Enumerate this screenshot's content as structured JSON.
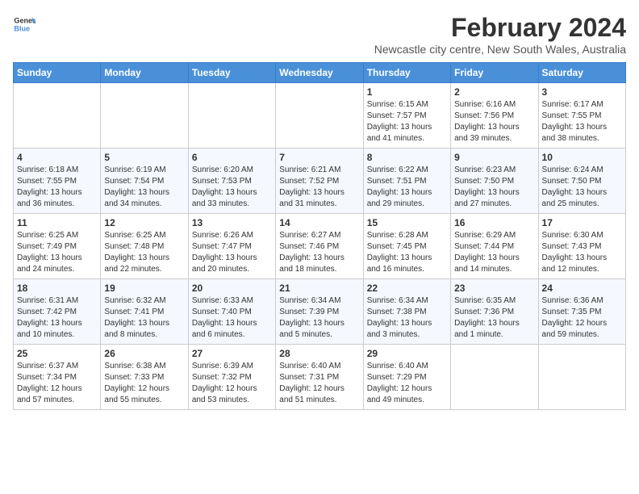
{
  "header": {
    "logo_line1": "General",
    "logo_line2": "Blue",
    "month_title": "February 2024",
    "location": "Newcastle city centre, New South Wales, Australia"
  },
  "weekdays": [
    "Sunday",
    "Monday",
    "Tuesday",
    "Wednesday",
    "Thursday",
    "Friday",
    "Saturday"
  ],
  "weeks": [
    [
      {
        "day": "",
        "info": ""
      },
      {
        "day": "",
        "info": ""
      },
      {
        "day": "",
        "info": ""
      },
      {
        "day": "",
        "info": ""
      },
      {
        "day": "1",
        "info": "Sunrise: 6:15 AM\nSunset: 7:57 PM\nDaylight: 13 hours\nand 41 minutes."
      },
      {
        "day": "2",
        "info": "Sunrise: 6:16 AM\nSunset: 7:56 PM\nDaylight: 13 hours\nand 39 minutes."
      },
      {
        "day": "3",
        "info": "Sunrise: 6:17 AM\nSunset: 7:55 PM\nDaylight: 13 hours\nand 38 minutes."
      }
    ],
    [
      {
        "day": "4",
        "info": "Sunrise: 6:18 AM\nSunset: 7:55 PM\nDaylight: 13 hours\nand 36 minutes."
      },
      {
        "day": "5",
        "info": "Sunrise: 6:19 AM\nSunset: 7:54 PM\nDaylight: 13 hours\nand 34 minutes."
      },
      {
        "day": "6",
        "info": "Sunrise: 6:20 AM\nSunset: 7:53 PM\nDaylight: 13 hours\nand 33 minutes."
      },
      {
        "day": "7",
        "info": "Sunrise: 6:21 AM\nSunset: 7:52 PM\nDaylight: 13 hours\nand 31 minutes."
      },
      {
        "day": "8",
        "info": "Sunrise: 6:22 AM\nSunset: 7:51 PM\nDaylight: 13 hours\nand 29 minutes."
      },
      {
        "day": "9",
        "info": "Sunrise: 6:23 AM\nSunset: 7:50 PM\nDaylight: 13 hours\nand 27 minutes."
      },
      {
        "day": "10",
        "info": "Sunrise: 6:24 AM\nSunset: 7:50 PM\nDaylight: 13 hours\nand 25 minutes."
      }
    ],
    [
      {
        "day": "11",
        "info": "Sunrise: 6:25 AM\nSunset: 7:49 PM\nDaylight: 13 hours\nand 24 minutes."
      },
      {
        "day": "12",
        "info": "Sunrise: 6:25 AM\nSunset: 7:48 PM\nDaylight: 13 hours\nand 22 minutes."
      },
      {
        "day": "13",
        "info": "Sunrise: 6:26 AM\nSunset: 7:47 PM\nDaylight: 13 hours\nand 20 minutes."
      },
      {
        "day": "14",
        "info": "Sunrise: 6:27 AM\nSunset: 7:46 PM\nDaylight: 13 hours\nand 18 minutes."
      },
      {
        "day": "15",
        "info": "Sunrise: 6:28 AM\nSunset: 7:45 PM\nDaylight: 13 hours\nand 16 minutes."
      },
      {
        "day": "16",
        "info": "Sunrise: 6:29 AM\nSunset: 7:44 PM\nDaylight: 13 hours\nand 14 minutes."
      },
      {
        "day": "17",
        "info": "Sunrise: 6:30 AM\nSunset: 7:43 PM\nDaylight: 13 hours\nand 12 minutes."
      }
    ],
    [
      {
        "day": "18",
        "info": "Sunrise: 6:31 AM\nSunset: 7:42 PM\nDaylight: 13 hours\nand 10 minutes."
      },
      {
        "day": "19",
        "info": "Sunrise: 6:32 AM\nSunset: 7:41 PM\nDaylight: 13 hours\nand 8 minutes."
      },
      {
        "day": "20",
        "info": "Sunrise: 6:33 AM\nSunset: 7:40 PM\nDaylight: 13 hours\nand 6 minutes."
      },
      {
        "day": "21",
        "info": "Sunrise: 6:34 AM\nSunset: 7:39 PM\nDaylight: 13 hours\nand 5 minutes."
      },
      {
        "day": "22",
        "info": "Sunrise: 6:34 AM\nSunset: 7:38 PM\nDaylight: 13 hours\nand 3 minutes."
      },
      {
        "day": "23",
        "info": "Sunrise: 6:35 AM\nSunset: 7:36 PM\nDaylight: 13 hours\nand 1 minute."
      },
      {
        "day": "24",
        "info": "Sunrise: 6:36 AM\nSunset: 7:35 PM\nDaylight: 12 hours\nand 59 minutes."
      }
    ],
    [
      {
        "day": "25",
        "info": "Sunrise: 6:37 AM\nSunset: 7:34 PM\nDaylight: 12 hours\nand 57 minutes."
      },
      {
        "day": "26",
        "info": "Sunrise: 6:38 AM\nSunset: 7:33 PM\nDaylight: 12 hours\nand 55 minutes."
      },
      {
        "day": "27",
        "info": "Sunrise: 6:39 AM\nSunset: 7:32 PM\nDaylight: 12 hours\nand 53 minutes."
      },
      {
        "day": "28",
        "info": "Sunrise: 6:40 AM\nSunset: 7:31 PM\nDaylight: 12 hours\nand 51 minutes."
      },
      {
        "day": "29",
        "info": "Sunrise: 6:40 AM\nSunset: 7:29 PM\nDaylight: 12 hours\nand 49 minutes."
      },
      {
        "day": "",
        "info": ""
      },
      {
        "day": "",
        "info": ""
      }
    ]
  ]
}
